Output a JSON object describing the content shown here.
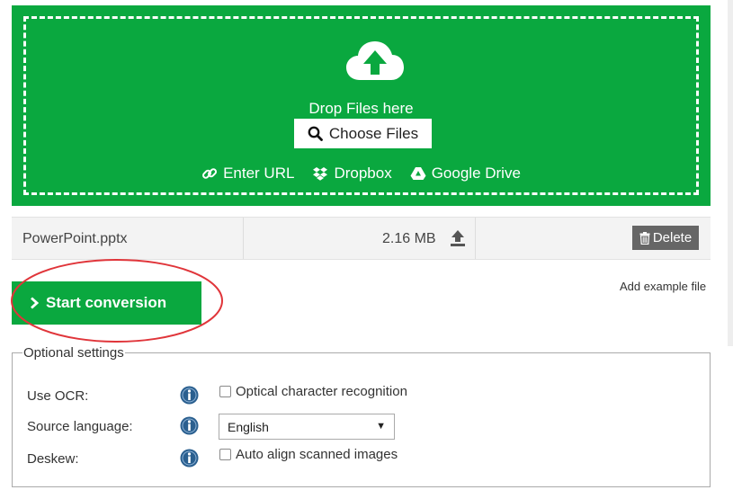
{
  "upload": {
    "drop_text": "Drop Files here",
    "choose_label": "Choose Files",
    "sources": [
      {
        "label": "Enter URL",
        "icon": "link-icon"
      },
      {
        "label": "Dropbox",
        "icon": "dropbox-icon"
      },
      {
        "label": "Google Drive",
        "icon": "google-drive-icon"
      }
    ],
    "icon": "cloud-upload-icon"
  },
  "file": {
    "name": "PowerPoint.pptx",
    "size": "2.16 MB",
    "delete_label": "Delete",
    "upload_icon": "upload-icon",
    "delete_icon": "trash-icon"
  },
  "actions": {
    "start_label": "Start conversion",
    "example_label": "Add example file"
  },
  "settings": {
    "legend": "Optional settings",
    "rows": [
      {
        "label": "Use OCR:",
        "checkbox_label": "Optical character recognition",
        "checked": false
      },
      {
        "label": "Source language:",
        "selected": "English"
      },
      {
        "label": "Deskew:",
        "checkbox_label": "Auto align scanned images",
        "checked": false
      }
    ]
  },
  "colors": {
    "brand_green": "#0aa83f",
    "highlight_red": "#e0353a",
    "info_blue": "#2a5f8f"
  }
}
